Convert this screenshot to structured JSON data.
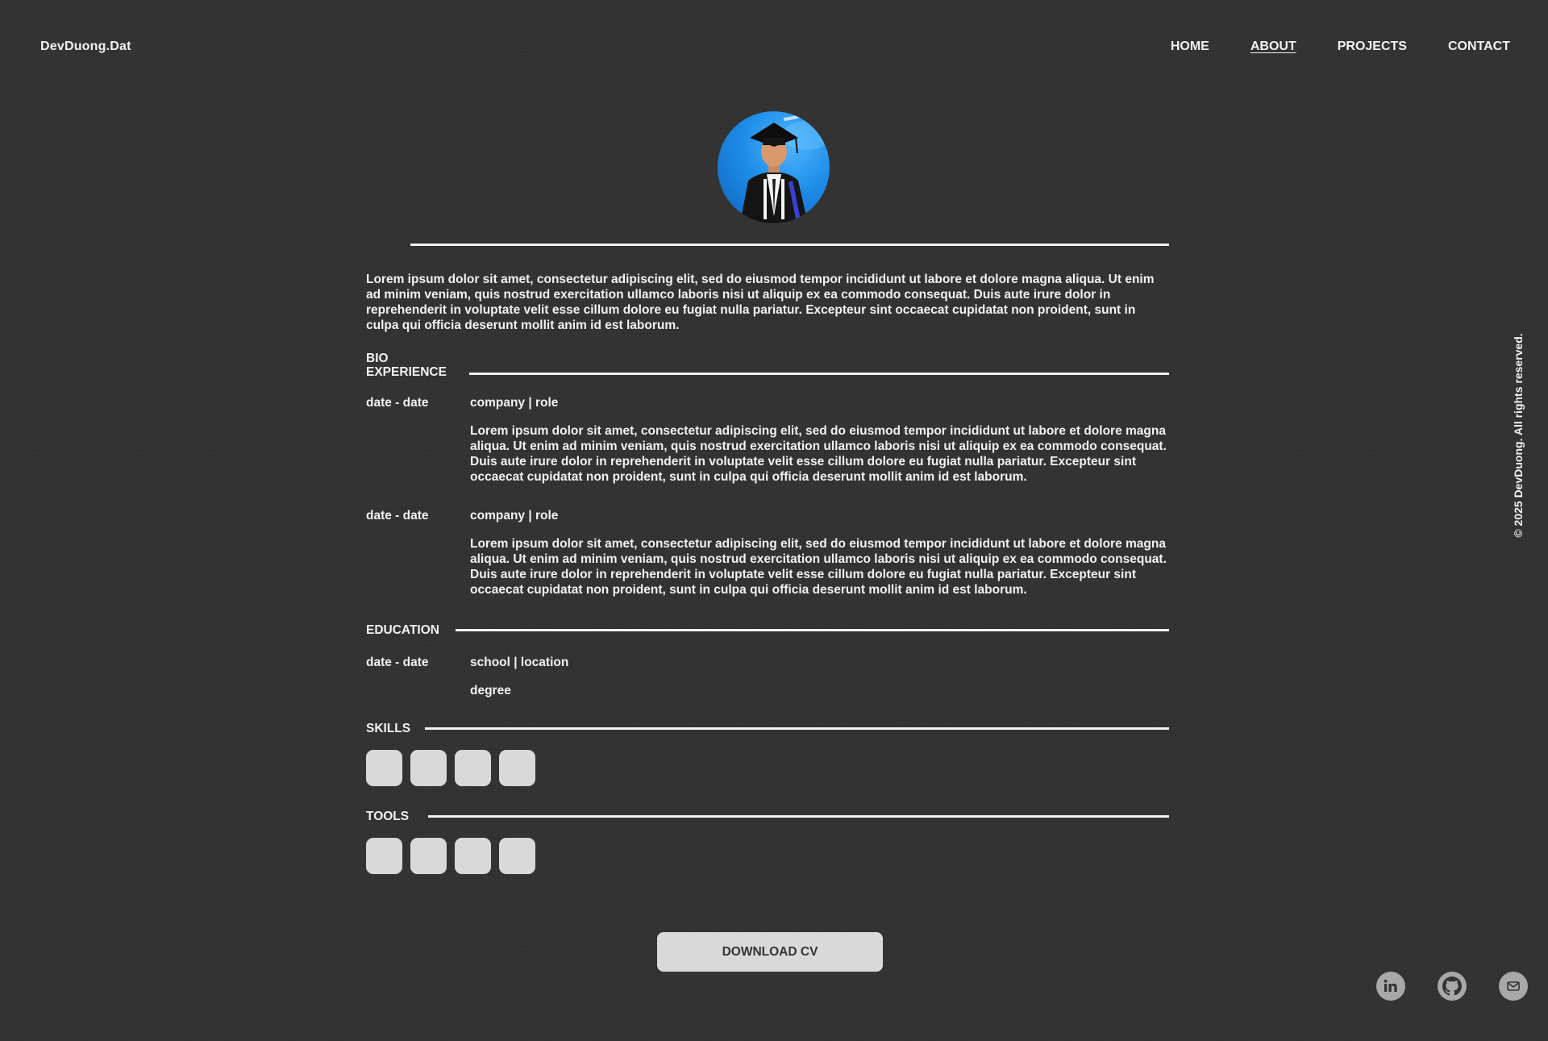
{
  "header": {
    "logo": "DevDuong.Dat",
    "nav": [
      "HOME",
      "ABOUT",
      "PROJECTS",
      "CONTACT"
    ],
    "active_nav": "ABOUT"
  },
  "intro": "Lorem ipsum dolor sit amet, consectetur adipiscing elit, sed do eiusmod tempor incididunt ut labore et dolore magna aliqua. Ut enim ad minim veniam, quis nostrud exercitation ullamco laboris nisi ut aliquip ex ea commodo consequat. Duis aute irure dolor in reprehenderit in voluptate velit esse cillum dolore eu fugiat nulla pariatur. Excepteur sint occaecat cupidatat non proident, sunt in culpa qui officia deserunt mollit anim id est laborum.",
  "sections": {
    "bio_label": "BIO",
    "experience_label": "EXPERIENCE",
    "education_label": "EDUCATION",
    "skills_label": "SKILLS",
    "tools_label": "TOOLS"
  },
  "experience": [
    {
      "date": "date - date",
      "title": "company | role",
      "desc": "Lorem ipsum dolor sit amet, consectetur adipiscing elit, sed do eiusmod tempor incididunt ut labore et dolore magna aliqua. Ut enim ad minim veniam, quis nostrud exercitation ullamco laboris nisi ut aliquip ex ea commodo consequat. Duis aute irure dolor in reprehenderit in voluptate velit esse cillum dolore eu fugiat nulla pariatur. Excepteur sint occaecat cupidatat non proident, sunt in culpa qui officia deserunt mollit anim id est laborum."
    },
    {
      "date": "date - date",
      "title": "company | role",
      "desc": "Lorem ipsum dolor sit amet, consectetur adipiscing elit, sed do eiusmod tempor incididunt ut labore et dolore magna aliqua. Ut enim ad minim veniam, quis nostrud exercitation ullamco laboris nisi ut aliquip ex ea commodo consequat. Duis aute irure dolor in reprehenderit in voluptate velit esse cillum dolore eu fugiat nulla pariatur. Excepteur sint occaecat cupidatat non proident, sunt in culpa qui officia deserunt mollit anim id est laborum."
    }
  ],
  "education": [
    {
      "date": "date - date",
      "title": "school | location",
      "degree": "degree"
    }
  ],
  "download_label": "DOWNLOAD CV",
  "copyright": "© 2025 DevDuong. All rights reserved.",
  "socials": [
    {
      "icon": "linkedin-icon"
    },
    {
      "icon": "github-icon"
    },
    {
      "icon": "mail-icon"
    }
  ],
  "colors": {
    "background": "#323232",
    "text": "#f2f2f2",
    "chip": "#d9d9d9",
    "social_bg": "#a8a8a8"
  }
}
